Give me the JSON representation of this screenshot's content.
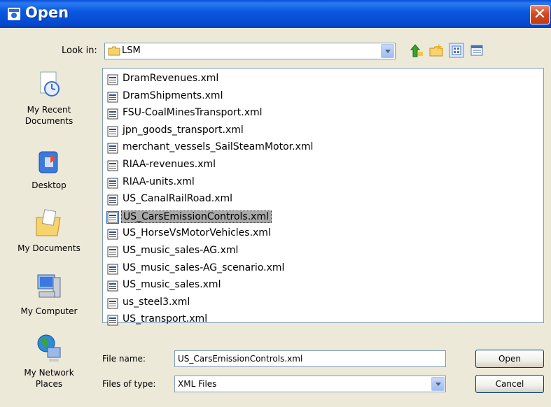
{
  "window": {
    "title": "Open"
  },
  "lookin": {
    "label": "Look in:",
    "value": "LSM"
  },
  "places": [
    {
      "label_line1": "My Recent",
      "label_line2": "Documents"
    },
    {
      "label_line1": "Desktop",
      "label_line2": ""
    },
    {
      "label_line1": "My Documents",
      "label_line2": ""
    },
    {
      "label_line1": "My Computer",
      "label_line2": ""
    },
    {
      "label_line1": "My Network",
      "label_line2": "Places"
    }
  ],
  "files": [
    "DramRevenues.xml",
    "DramShipments.xml",
    "FSU-CoalMinesTransport.xml",
    "jpn_goods_transport.xml",
    "merchant_vessels_SailSteamMotor.xml",
    "RIAA-revenues.xml",
    "RIAA-units.xml",
    "US_CanalRailRoad.xml",
    "US_CarsEmissionControls.xml",
    "US_HorseVsMotorVehicles.xml",
    "US_music_sales-AG.xml",
    "US_music_sales-AG_scenario.xml",
    "US_music_sales.xml",
    "us_steel3.xml",
    "US_transport.xml"
  ],
  "selected_file": "US_CarsEmissionControls.xml",
  "filename": {
    "label": "File name:",
    "value": "US_CarsEmissionControls.xml"
  },
  "filetype": {
    "label": "Files of type:",
    "value": "XML Files"
  },
  "buttons": {
    "open": "Open",
    "cancel": "Cancel"
  }
}
